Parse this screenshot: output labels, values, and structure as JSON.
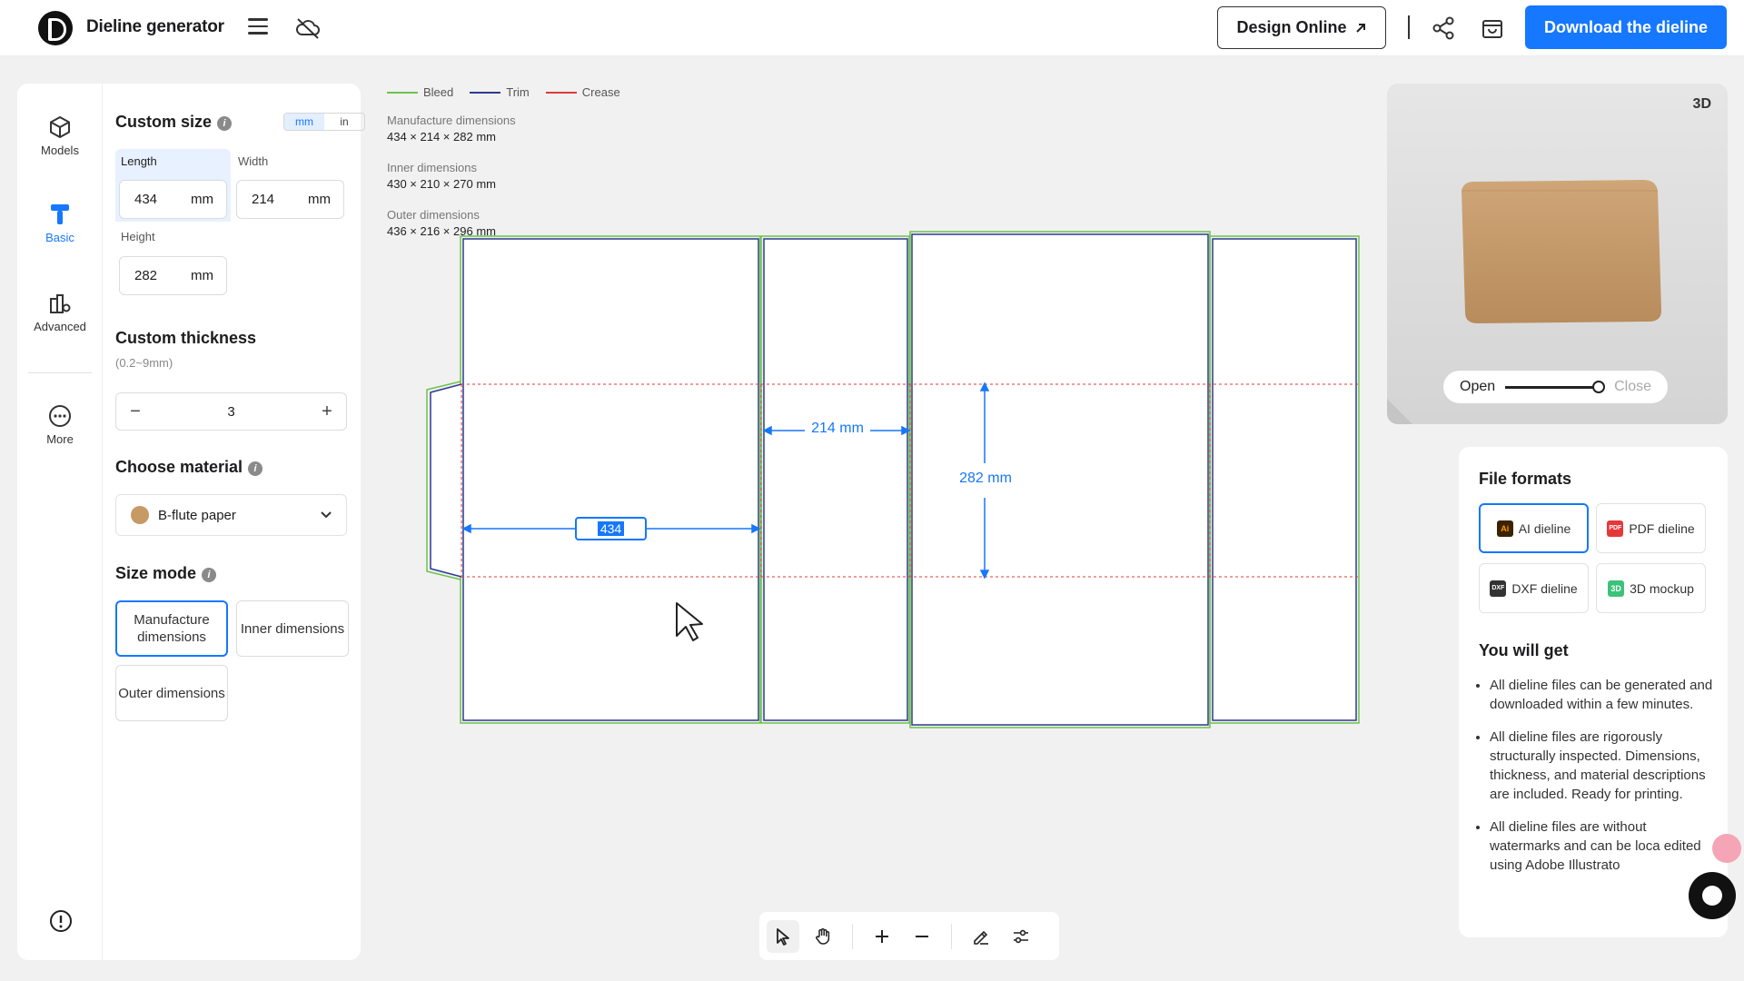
{
  "app": {
    "title": "Dieline generator"
  },
  "header": {
    "design_online_label": "Design Online",
    "download_label": "Download the dieline"
  },
  "rail": [
    {
      "label": "Models",
      "icon": "cube-icon"
    },
    {
      "label": "Basic",
      "icon": "basic-icon",
      "active": true
    },
    {
      "label": "Advanced",
      "icon": "advanced-icon"
    },
    {
      "label": "More",
      "icon": "more-icon"
    }
  ],
  "custom_size": {
    "title": "Custom size",
    "units": [
      "mm",
      "in"
    ],
    "active_unit": "mm",
    "length": {
      "label": "Length",
      "value": "434",
      "unit": "mm"
    },
    "width": {
      "label": "Width",
      "value": "214",
      "unit": "mm"
    },
    "height": {
      "label": "Height",
      "value": "282",
      "unit": "mm"
    }
  },
  "thickness": {
    "title": "Custom thickness",
    "range": "(0.2~9mm)",
    "value": "3",
    "minus": "−",
    "plus": "+"
  },
  "material": {
    "title": "Choose material",
    "selected": "B-flute paper",
    "swatch_color": "#c79a64"
  },
  "size_mode": {
    "title": "Size mode",
    "options": [
      "Manufacture dimensions",
      "Inner dimensions",
      "Outer dimensions"
    ],
    "active": "Manufacture dimensions"
  },
  "legend": [
    {
      "label": "Bleed",
      "color": "#6cc44a"
    },
    {
      "label": "Trim",
      "color": "#2d3b8f"
    },
    {
      "label": "Crease",
      "color": "#e0383e"
    }
  ],
  "dimensions": {
    "manufacture": {
      "title": "Manufacture dimensions",
      "value": "434 × 214 × 282 mm"
    },
    "inner": {
      "title": "Inner dimensions",
      "value": "430 × 210 × 270 mm"
    },
    "outer": {
      "title": "Outer dimensions",
      "value": "436 × 216 × 296 mm"
    }
  },
  "canvas_labels": {
    "length_edit": "434",
    "width": "214 mm",
    "height": "282 mm"
  },
  "preview": {
    "mode_label": "3D",
    "open_label": "Open",
    "close_label": "Close",
    "box_color": "#c49a6c"
  },
  "file_formats": {
    "title": "File formats",
    "items": [
      {
        "label": "AI dieline",
        "icon": "Ai",
        "color": "#3b2300",
        "active": true
      },
      {
        "label": "PDF dieline",
        "icon": "PDF",
        "color": "#e5383b"
      },
      {
        "label": "DXF dieline",
        "icon": "DXF",
        "color": "#333333"
      },
      {
        "label": "3D mockup",
        "icon": "3D",
        "color": "#3cc27a"
      }
    ],
    "you_will_get_title": "You will get",
    "benefits": [
      "All dieline files can be generated and downloaded within a few minutes.",
      "All dieline files are rigorously structurally inspected. Dimensions, thickness, and material descriptions are included. Ready for printing.",
      "All dieline files are without watermarks and can be loca edited using Adobe Illustrato"
    ]
  },
  "accent_color": "#1677ff"
}
